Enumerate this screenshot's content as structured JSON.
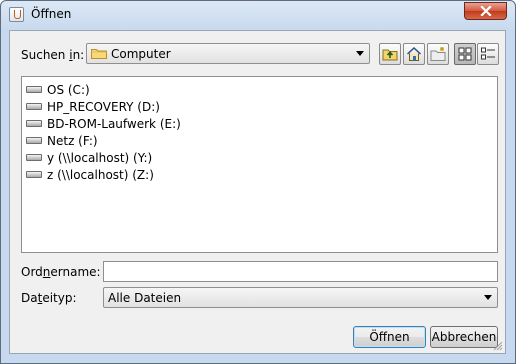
{
  "window": {
    "title": "Öffnen"
  },
  "look_in": {
    "label_pre": "Suchen ",
    "label_mnemonic": "i",
    "label_post": "n:",
    "value": "Computer"
  },
  "toolbar": [
    {
      "name": "up-one-level-button",
      "icon": "folder-up-icon"
    },
    {
      "name": "home-button",
      "icon": "home-icon"
    },
    {
      "name": "new-folder-button",
      "icon": "new-folder-icon"
    },
    {
      "name": "list-view-button",
      "icon": "list-view-icon",
      "pressed": true
    },
    {
      "name": "details-view-button",
      "icon": "details-view-icon"
    }
  ],
  "files": [
    {
      "label": "OS (C:)"
    },
    {
      "label": "HP_RECOVERY (D:)"
    },
    {
      "label": "BD-ROM-Laufwerk (E:)"
    },
    {
      "label": "Netz (F:)"
    },
    {
      "label": "y (\\\\localhost) (Y:)"
    },
    {
      "label": "z (\\\\localhost) (Z:)"
    }
  ],
  "folder_name": {
    "label_pre": "Ord",
    "label_mnemonic": "n",
    "label_post": "ername:",
    "value": ""
  },
  "file_type": {
    "label_pre": "Da",
    "label_mnemonic": "t",
    "label_post": "eityp:",
    "value": "Alle Dateien"
  },
  "buttons": {
    "open_label": "Öffnen",
    "cancel_label": "Abbrechen"
  },
  "colors": {
    "title_bar": "#c7d9ee",
    "close_button": "#c23a1c",
    "dialog_bg": "#f0f0f0",
    "default_button_border": "#3c7fb1"
  }
}
